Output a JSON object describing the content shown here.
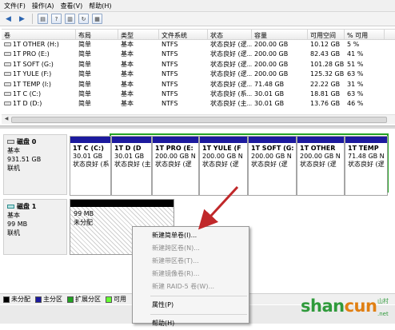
{
  "menu": [
    "文件(F)",
    "操作(A)",
    "查看(V)",
    "帮助(H)"
  ],
  "toolbar": {
    "icons": [
      "back-arrow-icon",
      "forward-arrow-icon",
      "volume-list-icon",
      "help-icon",
      "properties-icon",
      "refresh-icon",
      "help-book-icon"
    ]
  },
  "volume_table": {
    "headers": [
      "卷",
      "布局",
      "类型",
      "文件系统",
      "状态",
      "容量",
      "可用空间",
      "% 可用"
    ],
    "rows": [
      {
        "vol": "1T OTHER (H:)",
        "layout": "简单",
        "type": "基本",
        "fs": "NTFS",
        "status": "状态良好 (逻...",
        "cap": "200.00 GB",
        "free": "10.12 GB",
        "pct": "5 %"
      },
      {
        "vol": "1T PRO (E:)",
        "layout": "简单",
        "type": "基本",
        "fs": "NTFS",
        "status": "状态良好 (逻...",
        "cap": "200.00 GB",
        "free": "82.43 GB",
        "pct": "41 %"
      },
      {
        "vol": "1T SOFT (G:)",
        "layout": "简单",
        "type": "基本",
        "fs": "NTFS",
        "status": "状态良好 (逻...",
        "cap": "200.00 GB",
        "free": "101.28 GB",
        "pct": "51 %"
      },
      {
        "vol": "1T YULE (F:)",
        "layout": "简单",
        "type": "基本",
        "fs": "NTFS",
        "status": "状态良好 (逻...",
        "cap": "200.00 GB",
        "free": "125.32 GB",
        "pct": "63 %"
      },
      {
        "vol": "1T TEMP (I:)",
        "layout": "简单",
        "type": "基本",
        "fs": "NTFS",
        "status": "状态良好 (逻...",
        "cap": "71.48 GB",
        "free": "22.22 GB",
        "pct": "31 %"
      },
      {
        "vol": "1T C (C:)",
        "layout": "简单",
        "type": "基本",
        "fs": "NTFS",
        "status": "状态良好 (系...",
        "cap": "30.01 GB",
        "free": "18.81 GB",
        "pct": "63 %"
      },
      {
        "vol": "1T D (D:)",
        "layout": "简单",
        "type": "基本",
        "fs": "NTFS",
        "status": "状态良好 (主...",
        "cap": "30.01 GB",
        "free": "13.76 GB",
        "pct": "46 %"
      }
    ]
  },
  "disk0": {
    "name": "磁盘 0",
    "type": "基本",
    "size": "931.51 GB",
    "status": "联机",
    "partitions": [
      {
        "name": "1T C  (C:)",
        "size": "30.01 GB",
        "status": "状态良好 (系"
      },
      {
        "name": "1T D  (D",
        "size": "30.01 GB",
        "status": "状态良好 (主"
      },
      {
        "name": "1T PRO  (E:",
        "size": "200.00 GB N",
        "status": "状态良好 (逻"
      },
      {
        "name": "1T YULE  (F",
        "size": "200.00 GB N",
        "status": "状态良好 (逻"
      },
      {
        "name": "1T SOFT  (G:",
        "size": "200.00 GB N",
        "status": "状态良好 (逻"
      },
      {
        "name": "1T OTHER",
        "size": "200.00 GB N",
        "status": "状态良好 (逻"
      },
      {
        "name": "1T TEMP",
        "size": "71.48 GB N",
        "status": "状态良好 (逻"
      }
    ]
  },
  "disk1": {
    "name": "磁盘 1",
    "type": "基本",
    "size": "99 MB",
    "status": "联机",
    "unallocated": {
      "size": "99 MB",
      "label": "未分配"
    }
  },
  "context_menu": {
    "items": [
      {
        "label": "新建简单卷(I)...",
        "enabled": true
      },
      {
        "label": "新建跨区卷(N)...",
        "enabled": false
      },
      {
        "label": "新建带区卷(T)...",
        "enabled": false
      },
      {
        "label": "新建镜像卷(R)...",
        "enabled": false
      },
      {
        "label": "新建 RAID-5 卷(W)...",
        "enabled": false
      },
      {
        "label": "属性(P)",
        "enabled": true
      },
      {
        "label": "帮助(H)",
        "enabled": true
      }
    ]
  },
  "legend": [
    {
      "label": "未分配",
      "color": "#000000"
    },
    {
      "label": "主分区",
      "color": "#1c1a9e"
    },
    {
      "label": "扩展分区",
      "color": "#23a323"
    },
    {
      "label": "可用",
      "color": "#66ff33"
    }
  ],
  "watermark": {
    "main_a": "shan",
    "main_b": "cun",
    "sub": "山村",
    "tld": ".net"
  }
}
